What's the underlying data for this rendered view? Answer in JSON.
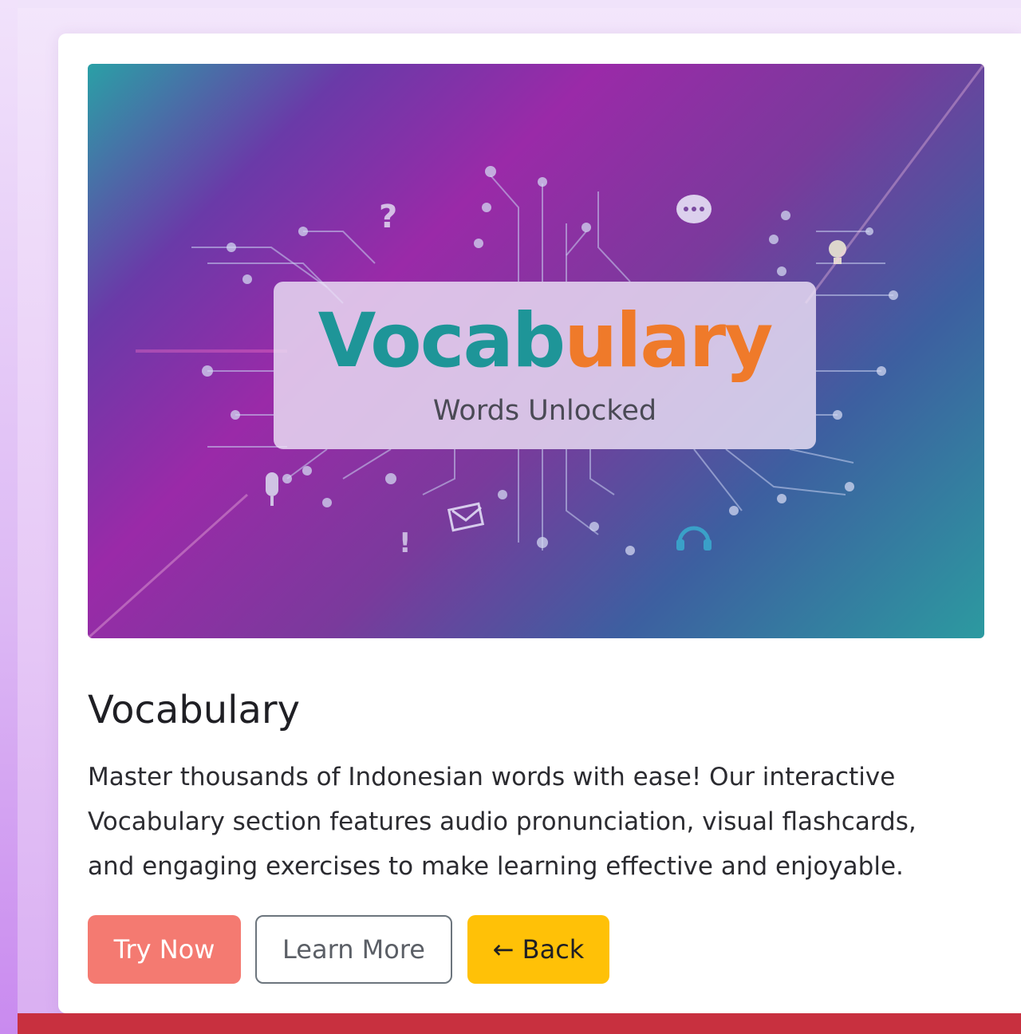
{
  "card": {
    "hero": {
      "title_part1": "Vocab",
      "title_part2": "ulary",
      "subtitle": "Words Unlocked",
      "icons": [
        "question-icon",
        "chat-bubble-icon",
        "lightbulb-icon",
        "microphone-icon",
        "envelope-icon",
        "exclamation-icon",
        "headphones-icon"
      ],
      "colors": {
        "title_teal": "#1e9598",
        "title_orange": "#ef7a2a"
      }
    },
    "title": "Vocabulary",
    "description": "Master thousands of Indonesian words with ease! Our interactive Vocabulary section features audio pronunciation, visual flashcards, and engaging exercises to make learning effective and enjoyable.",
    "buttons": {
      "try_now": "Try Now",
      "learn_more": "Learn More",
      "back": "← Back"
    }
  },
  "colors": {
    "try_now": "#f47a71",
    "back": "#ffc107",
    "footer": "#c8303f"
  }
}
